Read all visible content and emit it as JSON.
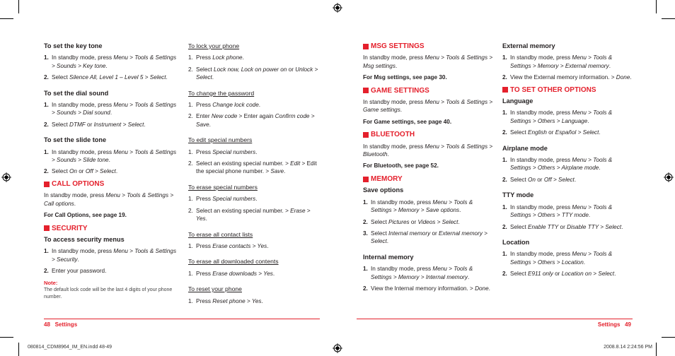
{
  "left_page": {
    "col1": {
      "key_tone": {
        "title": "To set the key tone",
        "steps": [
          [
            "1.",
            "In standby mode, press ",
            "Menu > Tools & Settings > Sounds > Key tone",
            "."
          ],
          [
            "2.",
            "Select ",
            "Silence All, Level 1 – Level 5 > Select",
            "."
          ]
        ]
      },
      "dial_sound": {
        "title": "To set the dial sound",
        "step1_num": "1.",
        "step1_a": "In standby mode, press ",
        "step1_b": "Menu > Tools & Settings > Sounds > Dial sound",
        "step1_c": ".",
        "step2_num": "2.",
        "step2_a": "Select ",
        "step2_b": "DTMF",
        "step2_c": " or ",
        "step2_d": "Instrument > Select",
        "step2_e": "."
      },
      "slide_tone": {
        "title": "To set the slide tone",
        "step1_num": "1.",
        "step1_a": "In standby mode, press ",
        "step1_b": "Menu > Tools & Settings > Sounds > Slide tone",
        "step1_c": ".",
        "step2_num": "2.",
        "step2_a": "Select ",
        "step2_b": "On",
        "step2_c": " or ",
        "step2_d": "Off > Select",
        "step2_e": "."
      },
      "call_options": {
        "section": "CALL OPTIONS",
        "para_a": "In standby mode, press ",
        "para_b": "Menu > Tools & Settings > Call options",
        "para_c": ".",
        "ref": "For Call Options, see page 19."
      },
      "security": {
        "section": "SECURITY",
        "title": "To access security menus",
        "step1_num": "1.",
        "step1_a": "In standby mode, press ",
        "step1_b": "Menu > Tools & Settings > Security",
        "step1_c": ".",
        "step2_num": "2.",
        "step2_a": "Enter your password.",
        "note_label": "Note:",
        "note_text": "The default lock code will be the last 4 digits of your phone number."
      }
    },
    "col2": {
      "lock": {
        "title": "To lock your phone",
        "s1n": "1.",
        "s1a": "Press ",
        "s1b": "Lock phone",
        "s1c": ".",
        "s2n": "2.",
        "s2a": "Select ",
        "s2b": "Lock now, Lock on power on",
        "s2c": " or ",
        "s2d": "Unlock > Select",
        "s2e": "."
      },
      "password": {
        "title": "To change the password",
        "s1n": "1.",
        "s1a": "Press ",
        "s1b": "Change lock code",
        "s1c": ".",
        "s2n": "2.",
        "s2a": "Enter ",
        "s2b": "New code",
        "s2c": " > Enter again ",
        "s2d": "Confirm code > Save",
        "s2e": "."
      },
      "edit_special": {
        "title": "To edit special numbers",
        "s1n": "1.",
        "s1a": "Press ",
        "s1b": "Special numbers",
        "s1c": ".",
        "s2n": "2.",
        "s2a": "Select an existing special number. > ",
        "s2b": "Edit",
        "s2c": " > Edit the special phone number. > ",
        "s2d": "Save",
        "s2e": "."
      },
      "erase_special": {
        "title": "To erase special numbers",
        "s1n": "1.",
        "s1a": "Press ",
        "s1b": "Special numbers",
        "s1c": ".",
        "s2n": "2.",
        "s2a": "Select an existing special number. > ",
        "s2b": "Erase > Yes",
        "s2c": "."
      },
      "erase_contacts": {
        "title": "To erase all contact lists",
        "s1n": "1.",
        "s1a": "Press ",
        "s1b": "Erase contacts > Yes",
        "s1c": "."
      },
      "erase_downloads": {
        "title": "To erase all downloaded contents",
        "s1n": "1.",
        "s1a": "Press ",
        "s1b": "Erase downloads > Yes",
        "s1c": "."
      },
      "reset": {
        "title": "To reset your phone",
        "s1n": "1.",
        "s1a": "Press ",
        "s1b": "Reset phone > Yes",
        "s1c": "."
      }
    },
    "footer": {
      "page_number": "48",
      "label": "Settings"
    }
  },
  "right_page": {
    "col3": {
      "msg": {
        "section": "MSG SETTINGS",
        "para_a": "In standby mode, press ",
        "para_b": "Menu > Tools & Settings > Msg settings",
        "para_c": ".",
        "ref": "For Msg settings, see page 30."
      },
      "game": {
        "section": "GAME SETTINGS",
        "para_a": "In standby mode, press ",
        "para_b": "Menu > Tools & Settings > Game settings",
        "para_c": ".",
        "ref": "For Game settings, see page 40."
      },
      "bluetooth": {
        "section": "BLUETOOTH",
        "para_a": "In standby mode, press ",
        "para_b": "Menu > Tools & Settings > Bluetooth",
        "para_c": ".",
        "ref": "For Bluetooth, see page 52."
      },
      "memory": {
        "section": "MEMORY",
        "save_title": "Save options",
        "save_s1n": "1.",
        "save_s1a": "In standby mode, press ",
        "save_s1b": "Menu > Tools & Settings > Memory > Save options",
        "save_s1c": ".",
        "save_s2n": "2.",
        "save_s2a": "Select ",
        "save_s2b": "Pictures",
        "save_s2c": " or ",
        "save_s2d": "Videos > Select",
        "save_s2e": ".",
        "save_s3n": "3.",
        "save_s3a": "Select ",
        "save_s3b": "Internal memory",
        "save_s3c": " or ",
        "save_s3d": "External memory > Select",
        "save_s3e": ".",
        "int_title": "Internal memory",
        "int_s1n": "1.",
        "int_s1a": "In standby mode, press ",
        "int_s1b": "Menu > Tools & Settings > Memory > Internal memory",
        "int_s1c": ".",
        "int_s2n": "2.",
        "int_s2a": "View the Internal memory information. > ",
        "int_s2b": "Done",
        "int_s2c": "."
      }
    },
    "col4": {
      "ext": {
        "title": "External memory",
        "s1n": "1.",
        "s1a": "In standby mode, press ",
        "s1b": "Menu > Tools & Settings > Memory > External memory",
        "s1c": ".",
        "s2n": "2.",
        "s2a": "View the External memory information. > ",
        "s2b": "Done",
        "s2c": "."
      },
      "other_section": "TO SET OTHER OPTIONS",
      "language": {
        "title": "Language",
        "s1n": "1.",
        "s1a": "In standby mode, press ",
        "s1b": "Menu > Tools & Settings > Others > Language",
        "s1c": ".",
        "s2n": "2.",
        "s2a": "Select ",
        "s2b": "English",
        "s2c": " or ",
        "s2d": "Español > Select",
        "s2e": "."
      },
      "airplane": {
        "title": "Airplane mode",
        "s1n": "1.",
        "s1a": "In standby mode, press ",
        "s1b": "Menu > Tools & Settings > Others > Airplane mode",
        "s1c": ".",
        "s2n": "2.",
        "s2a": "Select ",
        "s2b": "On",
        "s2c": " or ",
        "s2d": "Off > Select",
        "s2e": "."
      },
      "tty": {
        "title": "TTY mode",
        "s1n": "1.",
        "s1a": "In standby mode, press ",
        "s1b": "Menu > Tools & Settings > Others > TTY mode",
        "s1c": ".",
        "s2n": "2.",
        "s2a": "Select ",
        "s2b": "Enable TTY",
        "s2c": " or ",
        "s2d": "Disable TTY > Select",
        "s2e": "."
      },
      "location": {
        "title": "Location",
        "s1n": "1.",
        "s1a": "In standby mode, press ",
        "s1b": "Menu > Tools & Settings > Others > Location",
        "s1c": ".",
        "s2n": "2.",
        "s2a": "Select ",
        "s2b": "E911 only",
        "s2c": " or ",
        "s2d": "Location on > Select",
        "s2e": "."
      }
    },
    "footer": {
      "label": "Settings",
      "page_number": "49"
    }
  },
  "slug": {
    "filename": "080814_CDM8964_IM_EN.indd   48-49",
    "timestamp": "2008.8.14   2:24:56 PM"
  },
  "colors": {
    "accent": "#e4202c",
    "text": "#231f20"
  }
}
